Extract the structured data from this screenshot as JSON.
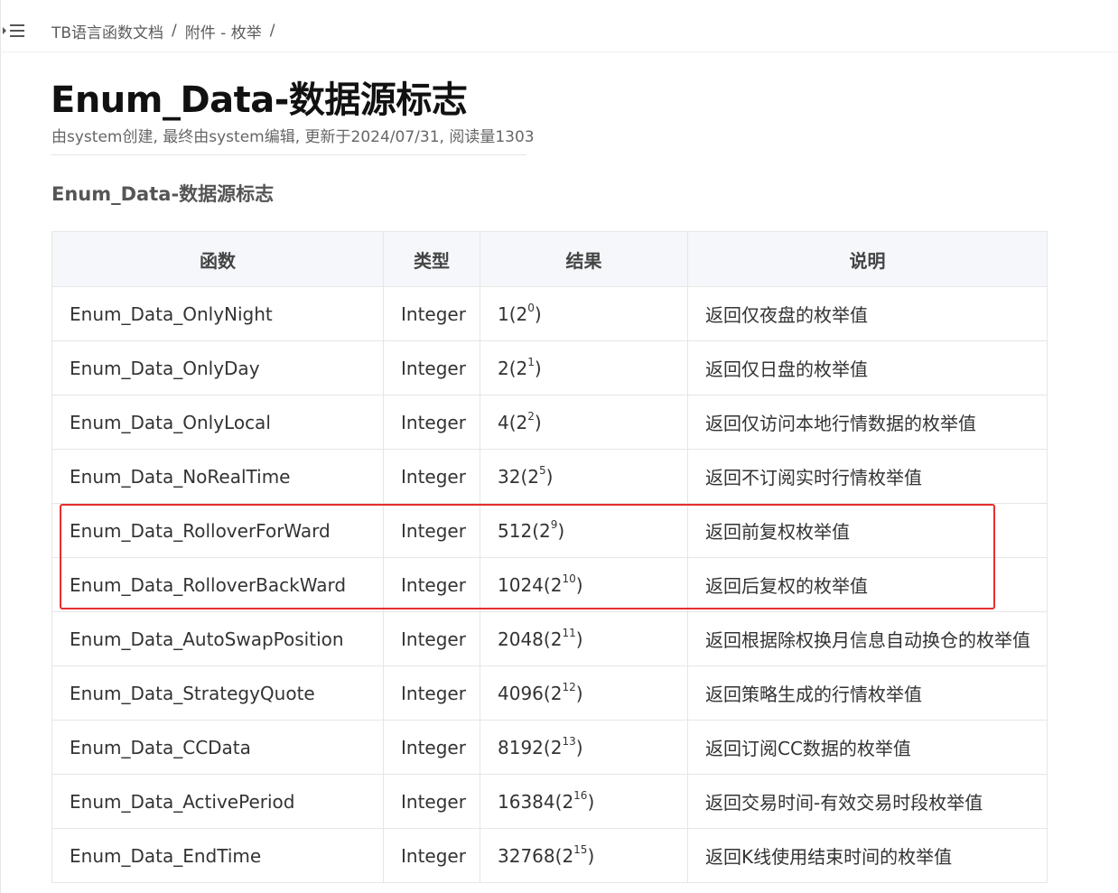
{
  "breadcrumb": {
    "items": [
      "TB语言函数文档",
      "附件 - 枚举"
    ],
    "separator": "/"
  },
  "page": {
    "title": "Enum_Data-数据源标志",
    "meta": "由system创建, 最终由system编辑, 更新于2024/07/31, 阅读量1303",
    "section_title": "Enum_Data-数据源标志"
  },
  "table": {
    "headers": [
      "函数",
      "类型",
      "结果",
      "说明"
    ],
    "rows": [
      {
        "func": "Enum_Data_OnlyNight",
        "type": "Integer",
        "value": "1",
        "base": "2",
        "exp": "0",
        "desc": "返回仅夜盘的枚举值"
      },
      {
        "func": "Enum_Data_OnlyDay",
        "type": "Integer",
        "value": "2",
        "base": "2",
        "exp": "1",
        "desc": "返回仅日盘的枚举值"
      },
      {
        "func": "Enum_Data_OnlyLocal",
        "type": "Integer",
        "value": "4",
        "base": "2",
        "exp": "2",
        "desc": "返回仅访问本地行情数据的枚举值"
      },
      {
        "func": "Enum_Data_NoRealTime",
        "type": "Integer",
        "value": "32",
        "base": "2",
        "exp": "5",
        "desc": "返回不订阅实时行情枚举值"
      },
      {
        "func": "Enum_Data_RolloverForWard",
        "type": "Integer",
        "value": "512",
        "base": "2",
        "exp": "9",
        "desc": "返回前复权枚举值"
      },
      {
        "func": "Enum_Data_RolloverBackWard",
        "type": "Integer",
        "value": "1024",
        "base": "2",
        "exp": "10",
        "desc": "返回后复权的枚举值"
      },
      {
        "func": "Enum_Data_AutoSwapPosition",
        "type": "Integer",
        "value": "2048",
        "base": "2",
        "exp": "11",
        "desc": "返回根据除权换月信息自动换仓的枚举值"
      },
      {
        "func": "Enum_Data_StrategyQuote",
        "type": "Integer",
        "value": "4096",
        "base": "2",
        "exp": "12",
        "desc": "返回策略生成的行情枚举值"
      },
      {
        "func": "Enum_Data_CCData",
        "type": "Integer",
        "value": "8192",
        "base": "2",
        "exp": "13",
        "desc": "返回订阅CC数据的枚举值"
      },
      {
        "func": "Enum_Data_ActivePeriod",
        "type": "Integer",
        "value": "16384",
        "base": "2",
        "exp": "16",
        "desc": "返回交易时间-有效交易时段枚举值"
      },
      {
        "func": "Enum_Data_EndTime",
        "type": "Integer",
        "value": "32768",
        "base": "2",
        "exp": "15",
        "desc": "返回K线使用结束时间的枚举值"
      }
    ]
  },
  "colors": {
    "highlight": "#e62e2e",
    "header_bg": "#f5f7fa",
    "border": "#e6e6e6"
  },
  "icons": {
    "toggle": "menu-collapse-icon"
  }
}
